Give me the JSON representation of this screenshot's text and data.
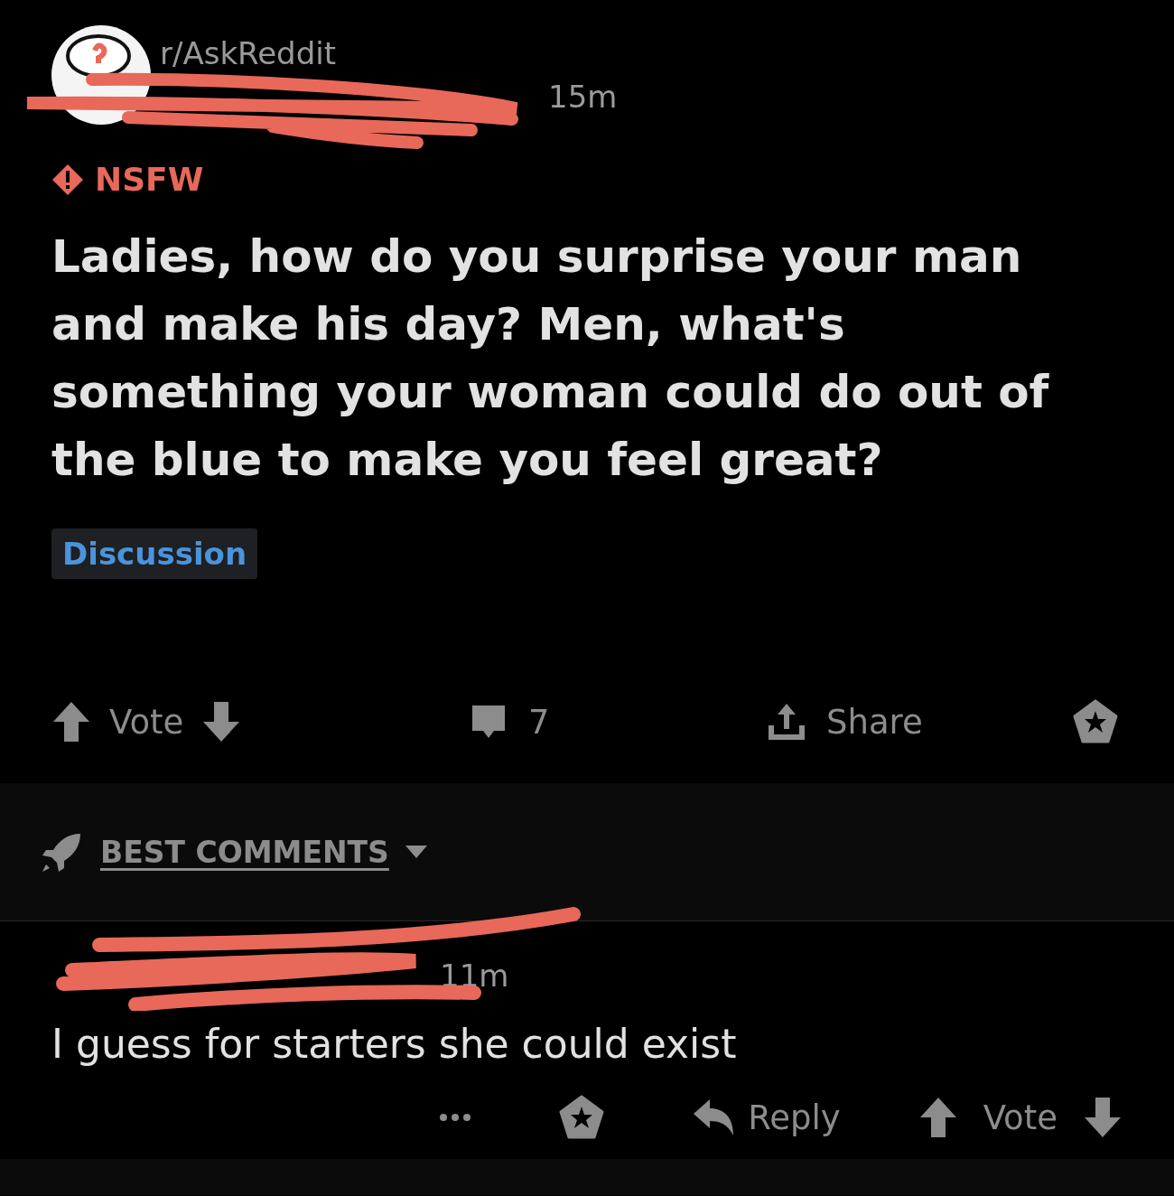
{
  "post": {
    "subreddit": "r/AskReddit",
    "age": "15m",
    "nsfw_label": "NSFW",
    "title": "Ladies, how do you surprise your man and make his day? Men, what's something your woman could do out of the blue to make you feel great?",
    "flair": "Discussion",
    "vote_label": "Vote",
    "comment_count": "7",
    "share_label": "Share"
  },
  "sort": {
    "label": "BEST COMMENTS"
  },
  "comments": [
    {
      "age": "11m",
      "body": "I guess for starters she could exist",
      "reply_label": "Reply",
      "vote_label": "Vote"
    }
  ]
}
